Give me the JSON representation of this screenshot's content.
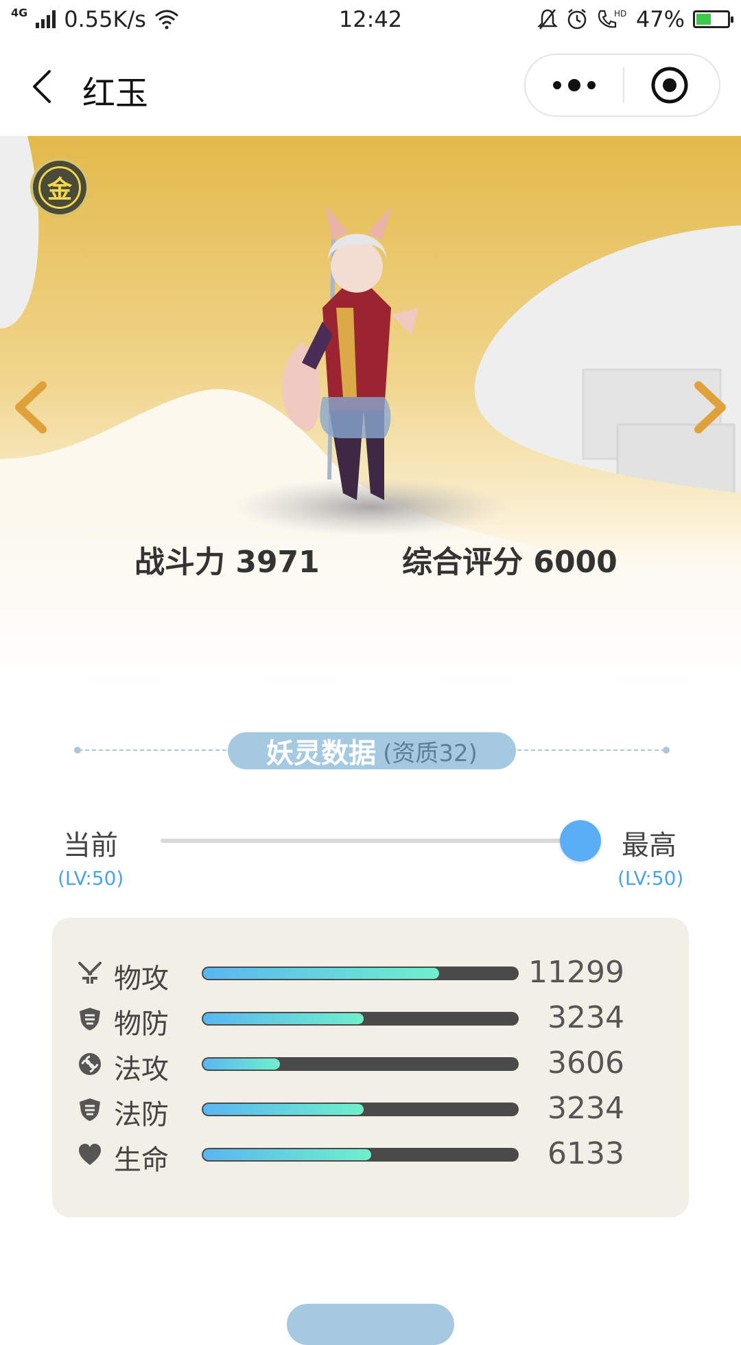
{
  "status_bar": {
    "network_type": "4G",
    "speed": "0.55K/s",
    "time": "12:42",
    "hd_label": "HD",
    "battery_percent": "47%",
    "battery_level": 0.47
  },
  "nav": {
    "title": "红玉"
  },
  "hero": {
    "grade_char": "金",
    "power_label": "战斗力",
    "power_value": "3971",
    "score_label": "综合评分",
    "score_value": "6000"
  },
  "section": {
    "title": "妖灵数据",
    "subtitle": "(资质32)"
  },
  "level": {
    "current_label": "当前",
    "current_level": "(LV:50)",
    "max_label": "最高",
    "max_level": "(LV:50)",
    "slider_fraction": 1.0
  },
  "stats": [
    {
      "icon": "sword-icon",
      "name": "物攻",
      "value": "11299",
      "fill_fraction": 0.75
    },
    {
      "icon": "shield-icon",
      "name": "物防",
      "value": "3234",
      "fill_fraction": 0.51
    },
    {
      "icon": "magic-swirl-icon",
      "name": "法攻",
      "value": "3606",
      "fill_fraction": 0.245
    },
    {
      "icon": "shield-icon",
      "name": "法防",
      "value": "3234",
      "fill_fraction": 0.51
    },
    {
      "icon": "heart-icon",
      "name": "生命",
      "value": "6133",
      "fill_fraction": 0.535
    }
  ],
  "colors": {
    "accent_blue": "#5aaef5",
    "section_pill": "#a6c9e2",
    "gold": "#e8c462",
    "bar_gradient_start": "#5ab6f2",
    "bar_gradient_end": "#6ff0cc",
    "panel_bg": "#f1efe6"
  }
}
